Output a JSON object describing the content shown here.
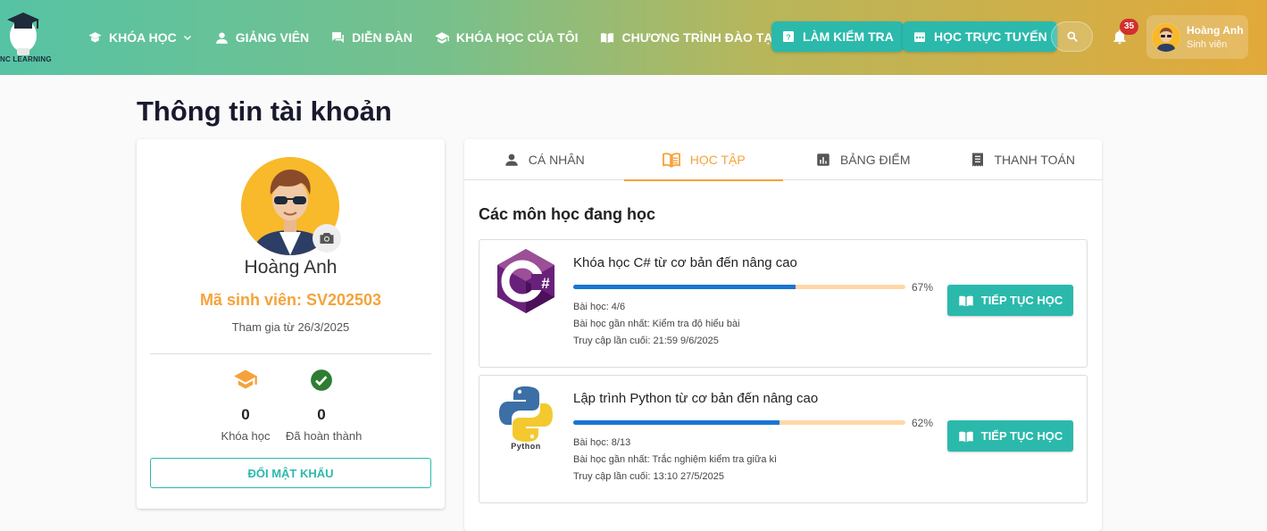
{
  "brand": {
    "name": "NC LEARNING"
  },
  "nav": {
    "items": [
      {
        "label": "KHÓA HỌC",
        "icon": "book-icon",
        "has_dropdown": true
      },
      {
        "label": "GIẢNG VIÊN",
        "icon": "person-icon"
      },
      {
        "label": "DIỄN ĐÀN",
        "icon": "forum-icon"
      },
      {
        "label": "KHÓA HỌC CỦA TÔI",
        "icon": "graduation-cap-icon"
      },
      {
        "label": "CHƯƠNG TRÌNH ĐÀO TẠO",
        "icon": "open-book-icon"
      }
    ],
    "quiz_button": "LÀM KIỂM TRA",
    "online_button": "HỌC TRỰC TUYẾN",
    "notification_count": "35"
  },
  "user": {
    "name": "Hoàng Anh",
    "role": "Sinh viên"
  },
  "page": {
    "title": "Thông tin tài khoản"
  },
  "profile": {
    "name": "Hoàng Anh",
    "student_id": "Mã sinh viên: SV202503",
    "join_date": "Tham gia từ 26/3/2025",
    "stats": [
      {
        "value": "0",
        "label": "Khóa học"
      },
      {
        "value": "0",
        "label": "Đã hoàn thành"
      }
    ],
    "change_password": "ĐỔI MẬT KHẨU"
  },
  "tabs": [
    {
      "label": "CÁ NHÂN",
      "active": false
    },
    {
      "label": "HỌC TẬP",
      "active": true
    },
    {
      "label": "BẢNG ĐIỂM",
      "active": false
    },
    {
      "label": "THANH TOÁN",
      "active": false
    }
  ],
  "learning": {
    "section_title": "Các môn học đang học",
    "continue_label": "TIẾP TỤC HỌC",
    "courses": [
      {
        "name": "Khóa học C# từ cơ bản đến nâng cao",
        "progress": 67,
        "progress_label": "67%",
        "lessons": "Bài học: 4/6",
        "last_lesson": "Bài học gần nhất: Kiểm tra độ hiểu bài",
        "last_access": "Truy cập lần cuối: 21:59 9/6/2025",
        "logo": "csharp-logo"
      },
      {
        "name": "Lập trình Python từ cơ bản đến nâng cao",
        "progress": 62,
        "progress_label": "62%",
        "lessons": "Bài học: 8/13",
        "last_lesson": "Bài học gần nhất: Trắc nghiệm kiểm tra giữa kì",
        "last_access": "Truy cập lần cuối: 13:10 27/5/2025",
        "logo": "python-logo",
        "logo_text": "Python"
      }
    ]
  },
  "colors": {
    "accent": "#2bb9ac",
    "orange": "#f4a33a",
    "progress": "#1976d2",
    "progress_track": "#ffd8a8"
  }
}
